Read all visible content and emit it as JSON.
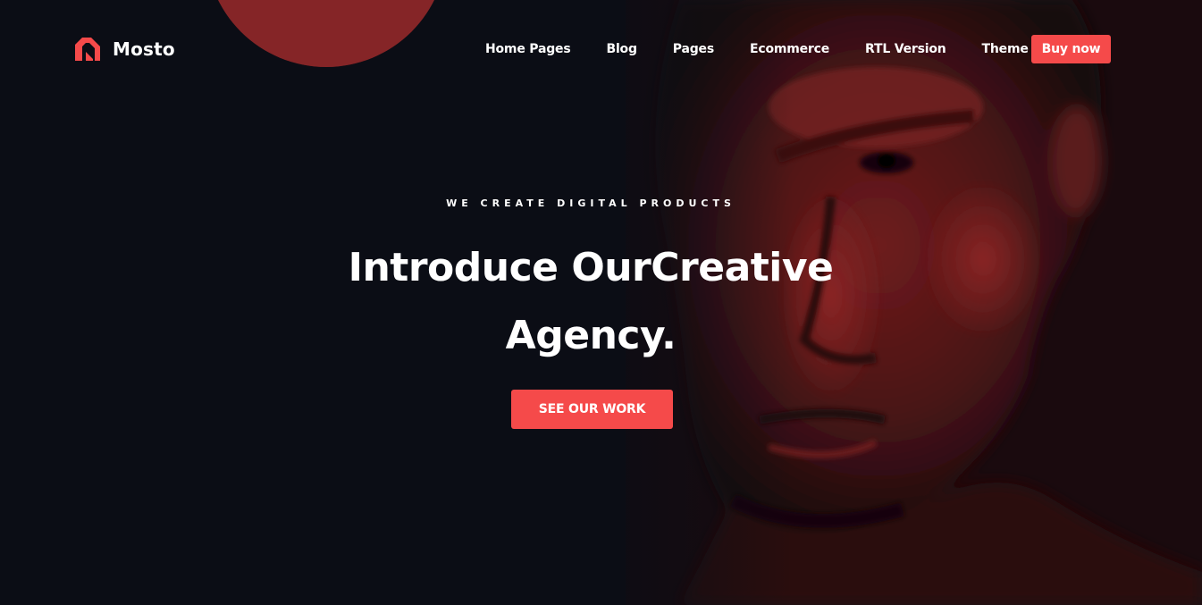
{
  "brand": {
    "name": "Mosto",
    "logo_icon": "mosto-logo-icon",
    "accent_color": "#f54a4a"
  },
  "nav": {
    "items": [
      {
        "label": "Home Pages"
      },
      {
        "label": "Blog"
      },
      {
        "label": "Pages"
      },
      {
        "label": "Ecommerce"
      },
      {
        "label": "RTL Version"
      },
      {
        "label": "Theme docs"
      }
    ],
    "cta_label": "Buy now"
  },
  "hero": {
    "eyebrow": "WE CREATE DIGITAL PRODUCTS",
    "title_line1": "Introduce OurCreative",
    "title_line2": "Agency.",
    "cta_label": "SEE OUR WORK",
    "background_image": "portrait-man-red-tint",
    "background_color": "#0b0d15"
  }
}
